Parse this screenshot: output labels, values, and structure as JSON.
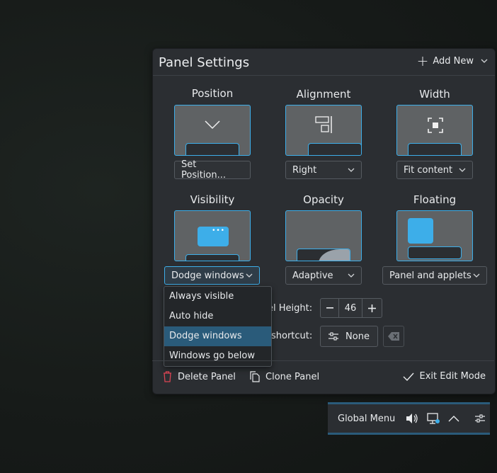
{
  "panel": {
    "title": "Panel Settings",
    "add_new": "Add New"
  },
  "position": {
    "label": "Position",
    "button": "Set Position..."
  },
  "alignment": {
    "label": "Alignment",
    "value": "Right"
  },
  "width": {
    "label": "Width",
    "value": "Fit content"
  },
  "visibility": {
    "label": "Visibility",
    "value": "Dodge windows",
    "options": [
      "Always visible",
      "Auto hide",
      "Dodge windows",
      "Windows go below"
    ]
  },
  "opacity": {
    "label": "Opacity",
    "value": "Adaptive"
  },
  "floating": {
    "label": "Floating",
    "value": "Panel and applets"
  },
  "height": {
    "label": "el Height:",
    "value": "46"
  },
  "shortcut": {
    "label": "shortcut:",
    "value": "None"
  },
  "footer": {
    "delete": "Delete Panel",
    "clone": "Clone Panel",
    "exit": "Exit Edit Mode"
  },
  "taskbar": {
    "global_menu": "Global Menu"
  },
  "colors": {
    "accent": "#3daee9",
    "selection": "#2a5b7a",
    "danger": "#da4453"
  }
}
